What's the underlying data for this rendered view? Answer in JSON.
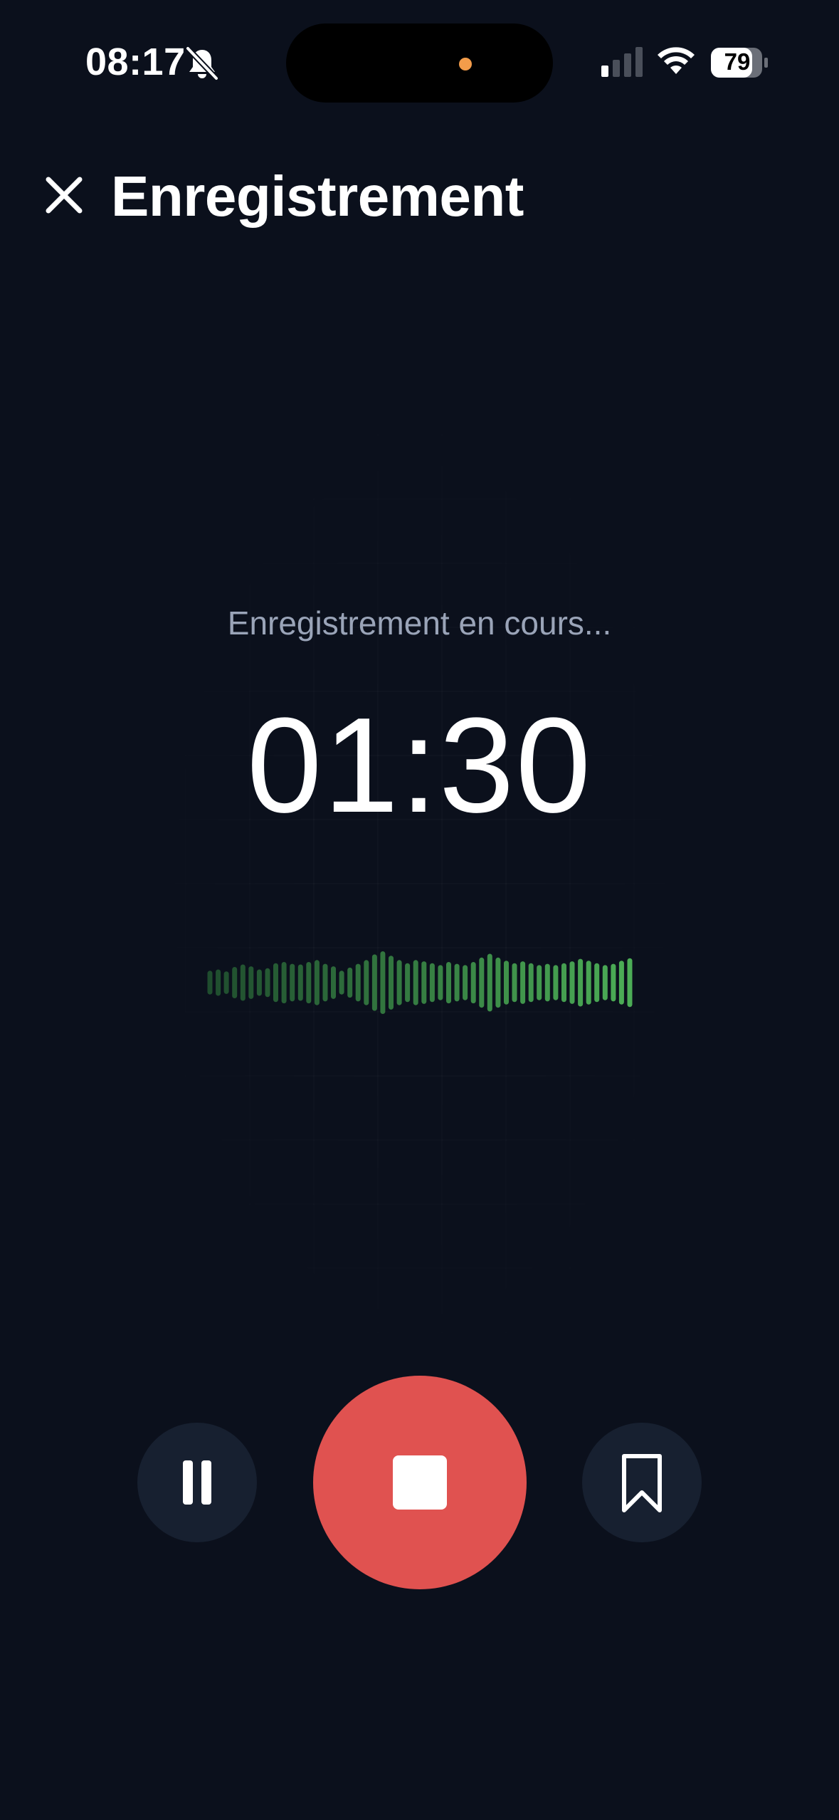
{
  "status_bar": {
    "time": "08:17",
    "battery": "79",
    "icons": [
      "bell-slash-icon",
      "cellular-signal-icon",
      "wifi-icon",
      "battery-icon"
    ]
  },
  "header": {
    "title": "Enregistrement",
    "close_icon": "close-icon"
  },
  "recording": {
    "status_text": "Enregistrement en cours...",
    "elapsed": "01:30",
    "waveform_levels": [
      0.38,
      0.42,
      0.36,
      0.5,
      0.58,
      0.52,
      0.42,
      0.46,
      0.62,
      0.66,
      0.6,
      0.58,
      0.66,
      0.72,
      0.6,
      0.52,
      0.38,
      0.48,
      0.6,
      0.72,
      0.9,
      1.0,
      0.86,
      0.72,
      0.62,
      0.72,
      0.68,
      0.62,
      0.56,
      0.66,
      0.6,
      0.56,
      0.66,
      0.8,
      0.92,
      0.8,
      0.7,
      0.62,
      0.68,
      0.62,
      0.56,
      0.6,
      0.56,
      0.62,
      0.68,
      0.76,
      0.7,
      0.62,
      0.56,
      0.6,
      0.7,
      0.78
    ],
    "waveform_color_start": "#1f4d2e",
    "waveform_color_end": "#4cad56"
  },
  "controls": {
    "pause_icon": "pause-icon",
    "stop_icon": "stop-icon",
    "bookmark_icon": "bookmark-icon",
    "stop_color": "#e05250"
  },
  "colors": {
    "background": "#0b101c",
    "muted_text": "#9aa4b8",
    "control_bg": "#172030"
  }
}
